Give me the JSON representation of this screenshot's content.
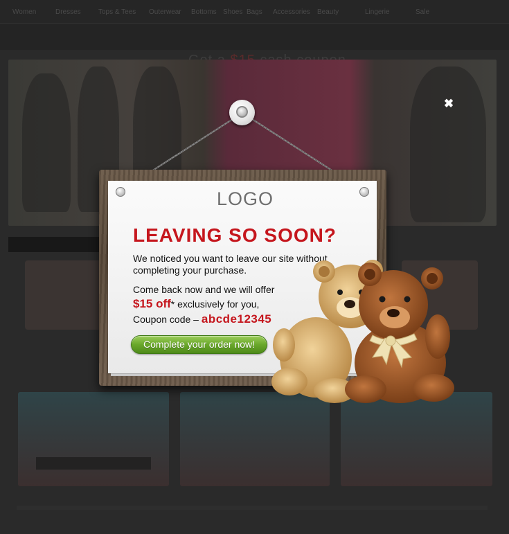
{
  "background": {
    "nav_items": [
      "Women",
      "Dresses",
      "Tops & Tees",
      "Outerwear",
      "Bottoms",
      "Shoes",
      "Bags",
      "Accessories",
      "Beauty",
      "Lingerie",
      "Sale"
    ],
    "promo": {
      "prefix": "Get a",
      "amount": "$15",
      "suffix": "cash coupon"
    }
  },
  "popup": {
    "close_symbol": "✖",
    "logo": "LOGO",
    "headline": "LEAVING SO SOON?",
    "message": "We noticed you want to leave our site without completing your purchase.",
    "offer_intro": "Come back now and we will offer",
    "offer_amount": "$15 off",
    "offer_asterisk": "*",
    "offer_suffix": " exclusively for you,",
    "coupon_label": "Coupon code – ",
    "coupon_code": "abcde12345",
    "cta_label": "Complete your order now!"
  },
  "colors": {
    "headline_red": "#c5161d",
    "cta_green": "#6aa82b"
  },
  "icons": {
    "close": "close-icon",
    "nail": "nail-icon",
    "teddy": "teddy-bears-illustration"
  }
}
